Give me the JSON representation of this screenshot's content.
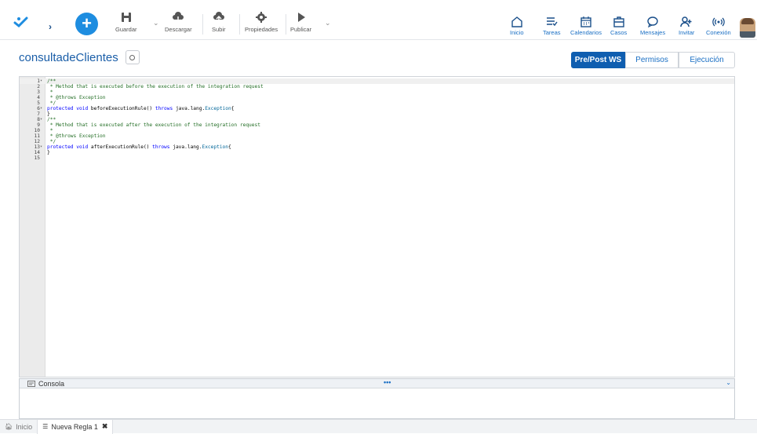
{
  "toolbar": {
    "guardar": "Guardar",
    "descargar": "Descargar",
    "subir": "Subir",
    "propiedades": "Propiedades",
    "publicar": "Publicar"
  },
  "nav": {
    "inicio": "Inicio",
    "tareas": "Tareas",
    "calendarios": "Calendarios",
    "casos": "Casos",
    "mensajes": "Mensajes",
    "invitar": "Invitar",
    "conexion": "Conexión"
  },
  "page": {
    "title": "consultadeClientes",
    "tabs": [
      "Pre/Post WS",
      "Permisos",
      "Ejecución"
    ]
  },
  "code_lines": [
    {
      "n": "1",
      "f": "▾",
      "segs": [
        {
          "t": "/**",
          "c": "cm"
        }
      ]
    },
    {
      "n": "2",
      "f": "",
      "segs": [
        {
          "t": " * Method that is executed before the execution of the integration request",
          "c": "cm"
        }
      ]
    },
    {
      "n": "3",
      "f": "",
      "segs": [
        {
          "t": " *",
          "c": "cm"
        }
      ]
    },
    {
      "n": "4",
      "f": "",
      "segs": [
        {
          "t": " * @throws Exception",
          "c": "cm"
        }
      ]
    },
    {
      "n": "5",
      "f": "",
      "segs": [
        {
          "t": " */",
          "c": "cm"
        }
      ]
    },
    {
      "n": "6",
      "f": "▾",
      "segs": [
        {
          "t": "protected",
          "c": "kw"
        },
        {
          "t": " ",
          "c": ""
        },
        {
          "t": "void",
          "c": "kw"
        },
        {
          "t": " beforeExecutionRule() ",
          "c": ""
        },
        {
          "t": "throws",
          "c": "kw"
        },
        {
          "t": " java.lang.",
          "c": ""
        },
        {
          "t": "Exception",
          "c": "ty"
        },
        {
          "t": "{",
          "c": ""
        }
      ]
    },
    {
      "n": "7",
      "f": "",
      "segs": [
        {
          "t": "}",
          "c": ""
        }
      ]
    },
    {
      "n": "8",
      "f": "▾",
      "segs": [
        {
          "t": "/**",
          "c": "cm"
        }
      ]
    },
    {
      "n": "9",
      "f": "",
      "segs": [
        {
          "t": " * Method that is executed after the execution of the integration request",
          "c": "cm"
        }
      ]
    },
    {
      "n": "10",
      "f": "",
      "segs": [
        {
          "t": " *",
          "c": "cm"
        }
      ]
    },
    {
      "n": "11",
      "f": "",
      "segs": [
        {
          "t": " * @throws Exception",
          "c": "cm"
        }
      ]
    },
    {
      "n": "12",
      "f": "",
      "segs": [
        {
          "t": " */",
          "c": "cm"
        }
      ]
    },
    {
      "n": "13",
      "f": "▾",
      "segs": [
        {
          "t": "protected",
          "c": "kw"
        },
        {
          "t": " ",
          "c": ""
        },
        {
          "t": "void",
          "c": "kw"
        },
        {
          "t": " afterExecutionRule() ",
          "c": ""
        },
        {
          "t": "throws",
          "c": "kw"
        },
        {
          "t": " java.lang.",
          "c": ""
        },
        {
          "t": "Exception",
          "c": "ty"
        },
        {
          "t": "{",
          "c": ""
        }
      ]
    },
    {
      "n": "14",
      "f": "",
      "segs": [
        {
          "t": "}",
          "c": ""
        }
      ]
    },
    {
      "n": "15",
      "f": "",
      "segs": []
    }
  ],
  "console": {
    "title": "Consola",
    "dots": "•••"
  },
  "bottom_tabs": {
    "home": "Inicio",
    "current": "Nueva Regla 1"
  },
  "colors": {
    "accent": "#1e8de0",
    "active_tab": "#0f5eb0",
    "link": "#1a6fc4"
  }
}
